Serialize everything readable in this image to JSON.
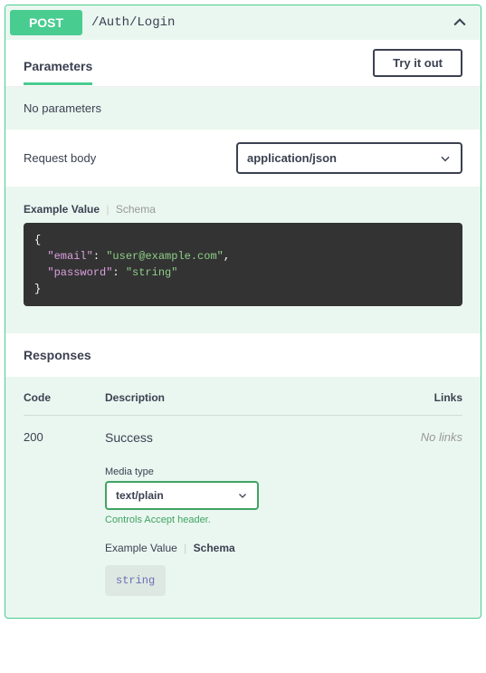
{
  "summary": {
    "method": "POST",
    "path": "/Auth/Login"
  },
  "parameters": {
    "title": "Parameters",
    "try_button": "Try it out",
    "empty_text": "No parameters"
  },
  "request_body": {
    "label": "Request body",
    "content_type": "application/json",
    "tabs": {
      "example": "Example Value",
      "schema": "Schema"
    },
    "example_json": {
      "email": "user@example.com",
      "password": "string"
    }
  },
  "responses": {
    "title": "Responses",
    "columns": {
      "code": "Code",
      "description": "Description",
      "links": "Links"
    },
    "items": [
      {
        "code": "200",
        "description": "Success",
        "links": "No links",
        "media_type_label": "Media type",
        "media_type": "text/plain",
        "controls_hint": "Controls Accept header.",
        "tabs": {
          "example": "Example Value",
          "schema": "Schema"
        },
        "schema_value": "string"
      }
    ]
  }
}
